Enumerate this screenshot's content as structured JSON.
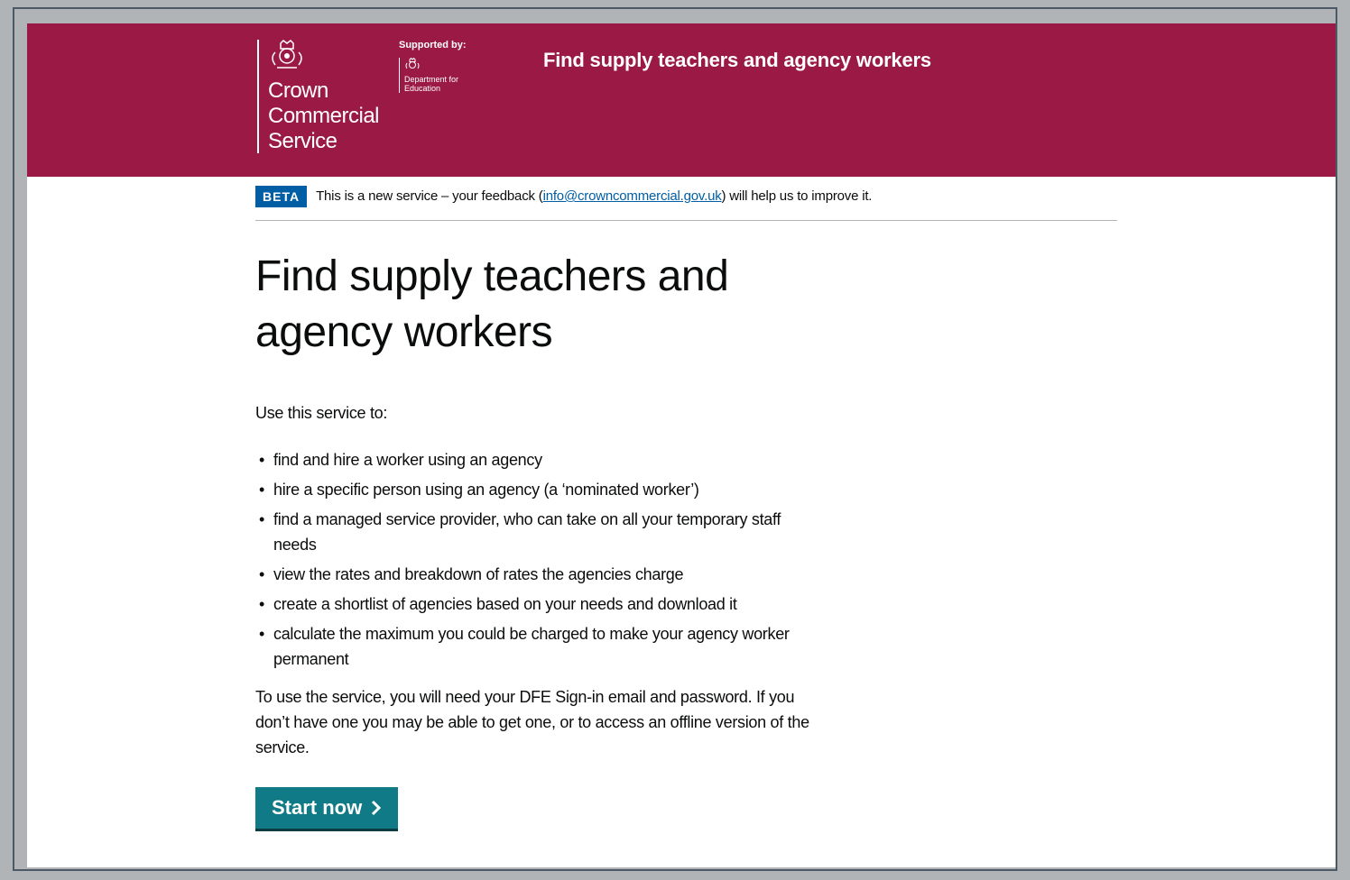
{
  "header": {
    "org_name": "Crown Commercial Service",
    "supported_label": "Supported by:",
    "partner_name": "Department for Education",
    "service_title": "Find supply teachers and agency workers",
    "background_color": "#9b1945"
  },
  "beta": {
    "tag": "BETA",
    "text_before": "This is a new service – your feedback (",
    "link_text": "info@crowncommercial.gov.uk",
    "text_after": ") will help us to improve it."
  },
  "main": {
    "heading": "Find supply teachers and agency workers",
    "intro": "Use this service to:",
    "bullets": [
      "find and hire a worker using an agency",
      "hire a specific person using an agency (a ‘nominated worker’)",
      "find a managed service provider, who can take on all your temporary staff needs",
      "view the rates and breakdown of rates the agencies charge",
      "create a shortlist of agencies based on your needs and download it",
      "calculate the maximum you could be charged to make your agency worker permanent"
    ],
    "body": "To use the service, you will need your DFE Sign-in email and password. If you don’t have one you may be able to get one, or to access an offline version of the service.",
    "start_label": "Start now",
    "start_color": "#107a86"
  },
  "icons": {
    "crest": "royal-crest-icon",
    "partner_crest": "royal-crest-icon",
    "start_chevron": "chevron-right-icon"
  }
}
